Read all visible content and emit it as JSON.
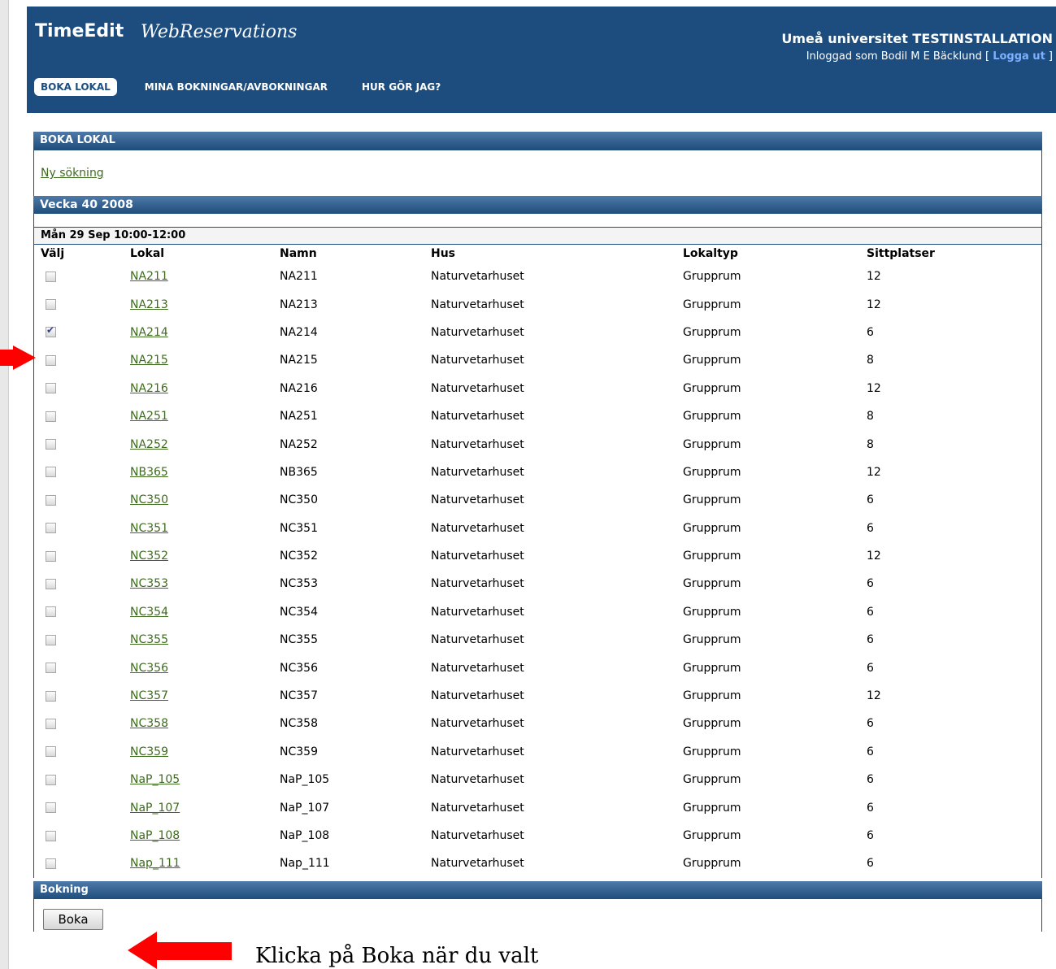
{
  "header": {
    "logo_bold": "TimeEdit",
    "logo_script": "WebReservations",
    "organization": "Umeå universitet TESTINSTALLATION",
    "login_prefix": "Inloggad som Bodil M E Bäcklund [",
    "logout_label": "Logga ut",
    "login_suffix": "]",
    "nav": [
      {
        "label": "BOKA LOKAL",
        "active": true
      },
      {
        "label": "MINA BOKNINGAR/AVBOKNINGAR",
        "active": false
      },
      {
        "label": "HUR GÖR JAG?",
        "active": false
      }
    ]
  },
  "section_title": "BOKA LOKAL",
  "new_search_label": "Ny sökning",
  "week_label": "Vecka 40 2008",
  "day_label": "Mån 29 Sep 10:00-12:00",
  "columns": [
    "Välj",
    "Lokal",
    "Namn",
    "Hus",
    "Lokaltyp",
    "Sittplatser"
  ],
  "rows": [
    {
      "lokal": "NA211",
      "namn": "NA211",
      "hus": "Naturvetarhuset",
      "typ": "Grupprum",
      "platser": "12",
      "checked": false
    },
    {
      "lokal": "NA213",
      "namn": "NA213",
      "hus": "Naturvetarhuset",
      "typ": "Grupprum",
      "platser": "12",
      "checked": false
    },
    {
      "lokal": "NA214",
      "namn": "NA214",
      "hus": "Naturvetarhuset",
      "typ": "Grupprum",
      "platser": "6",
      "checked": true
    },
    {
      "lokal": "NA215",
      "namn": "NA215",
      "hus": "Naturvetarhuset",
      "typ": "Grupprum",
      "platser": "8",
      "checked": false
    },
    {
      "lokal": "NA216",
      "namn": "NA216",
      "hus": "Naturvetarhuset",
      "typ": "Grupprum",
      "platser": "12",
      "checked": false
    },
    {
      "lokal": "NA251",
      "namn": "NA251",
      "hus": "Naturvetarhuset",
      "typ": "Grupprum",
      "platser": "8",
      "checked": false
    },
    {
      "lokal": "NA252",
      "namn": "NA252",
      "hus": "Naturvetarhuset",
      "typ": "Grupprum",
      "platser": "8",
      "checked": false
    },
    {
      "lokal": "NB365",
      "namn": "NB365",
      "hus": "Naturvetarhuset",
      "typ": "Grupprum",
      "platser": "12",
      "checked": false
    },
    {
      "lokal": "NC350",
      "namn": "NC350",
      "hus": "Naturvetarhuset",
      "typ": "Grupprum",
      "platser": "6",
      "checked": false
    },
    {
      "lokal": "NC351",
      "namn": "NC351",
      "hus": "Naturvetarhuset",
      "typ": "Grupprum",
      "platser": "6",
      "checked": false
    },
    {
      "lokal": "NC352",
      "namn": "NC352",
      "hus": "Naturvetarhuset",
      "typ": "Grupprum",
      "platser": "12",
      "checked": false
    },
    {
      "lokal": "NC353",
      "namn": "NC353",
      "hus": "Naturvetarhuset",
      "typ": "Grupprum",
      "platser": "6",
      "checked": false
    },
    {
      "lokal": "NC354",
      "namn": "NC354",
      "hus": "Naturvetarhuset",
      "typ": "Grupprum",
      "platser": "6",
      "checked": false
    },
    {
      "lokal": "NC355",
      "namn": "NC355",
      "hus": "Naturvetarhuset",
      "typ": "Grupprum",
      "platser": "6",
      "checked": false
    },
    {
      "lokal": "NC356",
      "namn": "NC356",
      "hus": "Naturvetarhuset",
      "typ": "Grupprum",
      "platser": "6",
      "checked": false
    },
    {
      "lokal": "NC357",
      "namn": "NC357",
      "hus": "Naturvetarhuset",
      "typ": "Grupprum",
      "platser": "12",
      "checked": false
    },
    {
      "lokal": "NC358",
      "namn": "NC358",
      "hus": "Naturvetarhuset",
      "typ": "Grupprum",
      "platser": "6",
      "checked": false
    },
    {
      "lokal": "NC359",
      "namn": "NC359",
      "hus": "Naturvetarhuset",
      "typ": "Grupprum",
      "platser": "6",
      "checked": false
    },
    {
      "lokal": "NaP_105",
      "namn": "NaP_105",
      "hus": "Naturvetarhuset",
      "typ": "Grupprum",
      "platser": "6",
      "checked": false
    },
    {
      "lokal": "NaP_107",
      "namn": "NaP_107",
      "hus": "Naturvetarhuset",
      "typ": "Grupprum",
      "platser": "6",
      "checked": false
    },
    {
      "lokal": "NaP_108",
      "namn": "NaP_108",
      "hus": "Naturvetarhuset",
      "typ": "Grupprum",
      "platser": "6",
      "checked": false
    },
    {
      "lokal": "Nap_111",
      "namn": "Nap_111",
      "hus": "Naturvetarhuset",
      "typ": "Grupprum",
      "platser": "6",
      "checked": false
    }
  ],
  "booking_section_title": "Bokning",
  "book_button_label": "Boka",
  "annotation_text": "Klicka på Boka när du valt",
  "colors": {
    "banner": "#1c4d7e",
    "link": "#3e6b1f",
    "arrow": "#ff0000"
  }
}
